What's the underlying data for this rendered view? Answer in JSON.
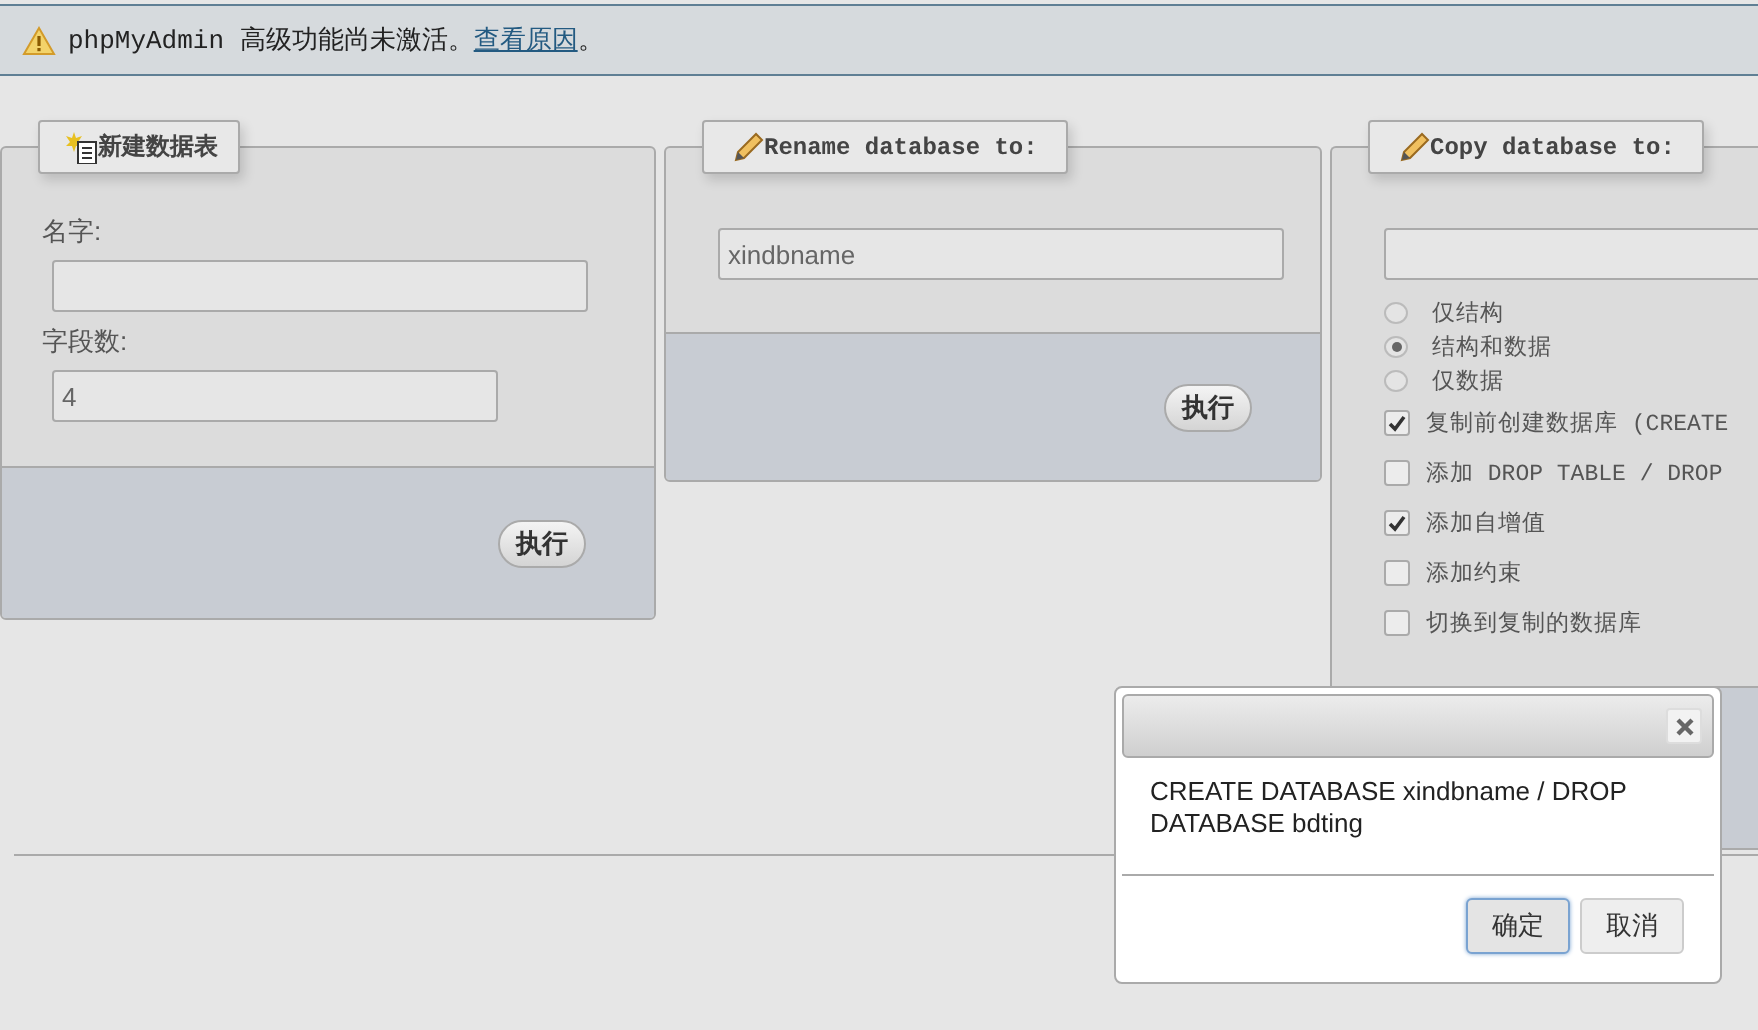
{
  "notice": {
    "text": "phpMyAdmin 高级功能尚未激活。",
    "link": "查看原因",
    "tail": "。"
  },
  "create_table": {
    "title": "新建数据表",
    "fields": [
      {
        "label": "名字:"
      },
      {
        "label": "字段数:",
        "value": "4"
      }
    ],
    "button": "执行"
  },
  "rename": {
    "title": "Rename database to:",
    "value": "xindbname",
    "button": "执行"
  },
  "copy": {
    "title": "Copy database to:",
    "options": [
      {
        "kind": "radio",
        "label": "仅结构",
        "selected": false
      },
      {
        "kind": "radio",
        "label": "结构和数据",
        "selected": true
      },
      {
        "kind": "radio",
        "label": "仅数据",
        "selected": false
      },
      {
        "kind": "checkbox",
        "label": "复制前创建数据库 (CREATE",
        "checked": true
      },
      {
        "kind": "checkbox",
        "label": "添加 DROP TABLE / DROP",
        "checked": false
      },
      {
        "kind": "checkbox",
        "label": "添加自增值",
        "checked": true
      },
      {
        "kind": "checkbox",
        "label": "添加约束",
        "checked": false
      },
      {
        "kind": "checkbox",
        "label": "切换到复制的数据库",
        "checked": false
      }
    ]
  },
  "dialog": {
    "message": "CREATE DATABASE xindbname / DROP DATABASE bdting",
    "buttons": [
      {
        "label": "确定",
        "focused": true
      },
      {
        "label": "取消",
        "focused": false
      }
    ]
  }
}
